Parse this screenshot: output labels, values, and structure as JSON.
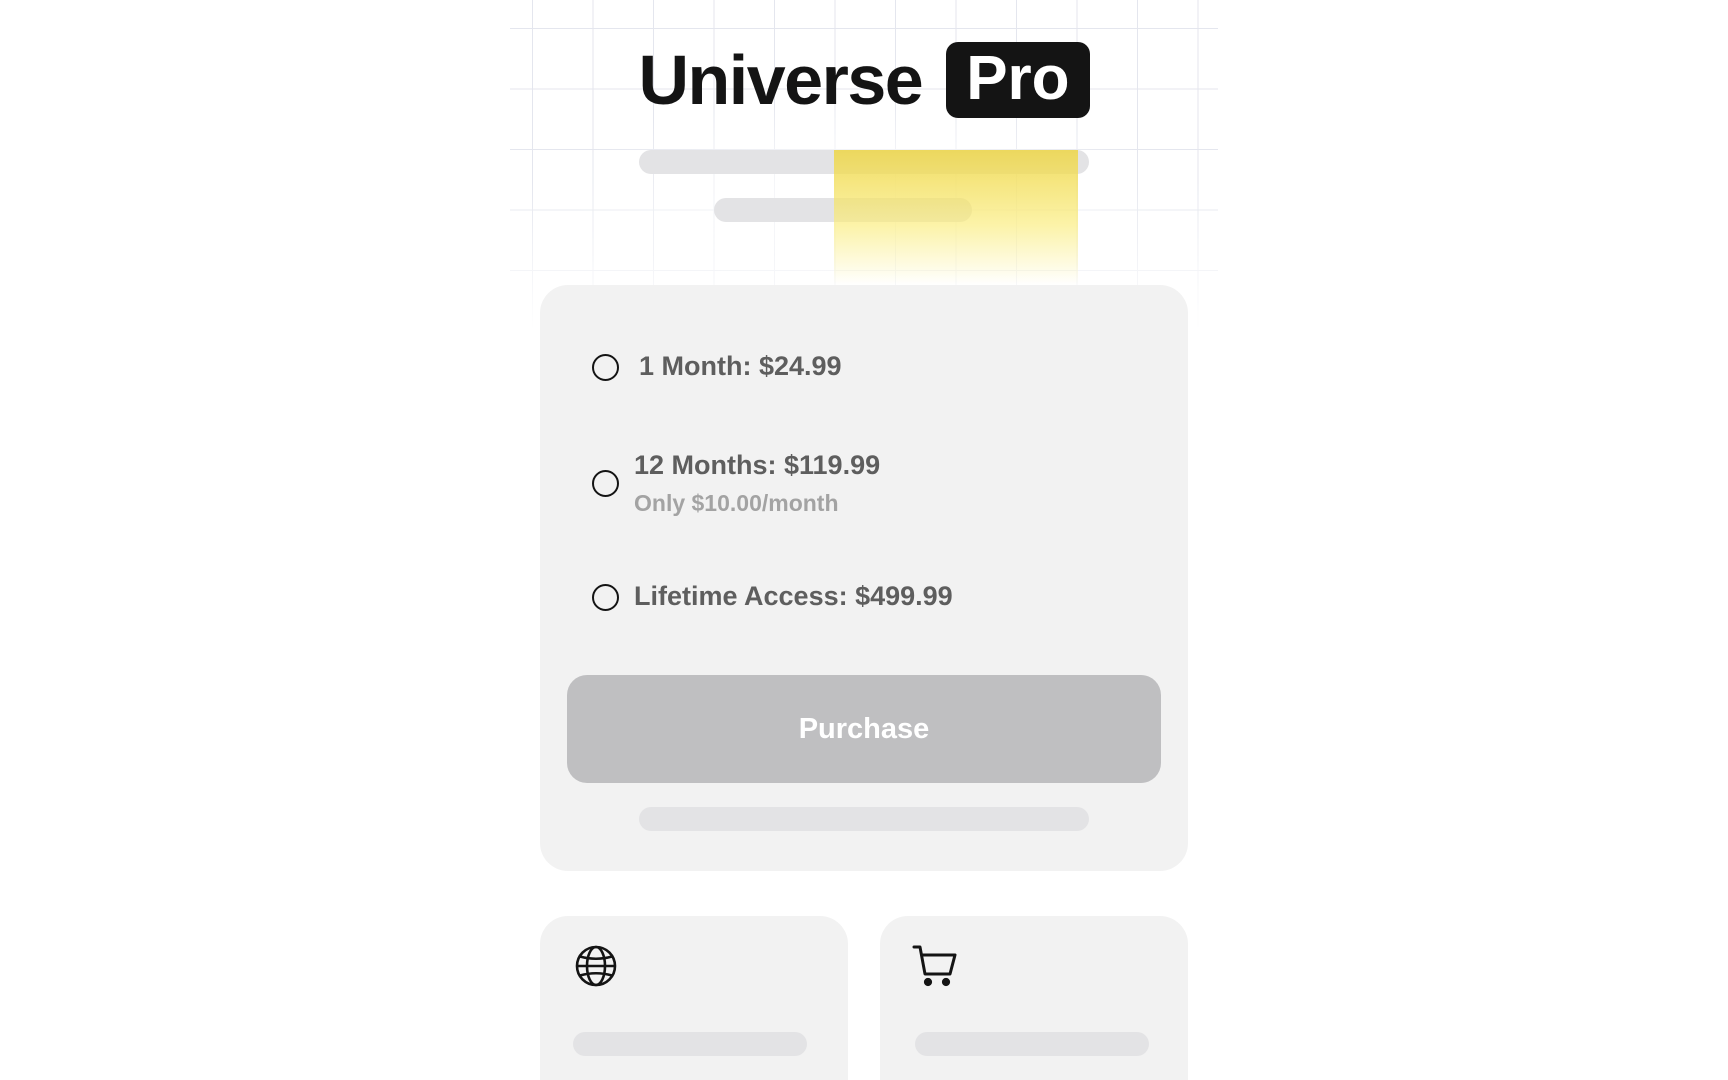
{
  "header": {
    "title_word": "Universe",
    "title_badge": "Pro",
    "highlight_color": "#F3E06A"
  },
  "plans": {
    "options": [
      {
        "label": "1 Month: $24.99",
        "sub": ""
      },
      {
        "label": "12 Months: $119.99",
        "sub": "Only $10.00/month"
      },
      {
        "label": "Lifetime Access: $499.99",
        "sub": ""
      }
    ],
    "purchase_label": "Purchase",
    "purchase_color": "#BFBFC1"
  },
  "features": [
    {
      "icon": "globe-icon"
    },
    {
      "icon": "cart-icon"
    }
  ]
}
